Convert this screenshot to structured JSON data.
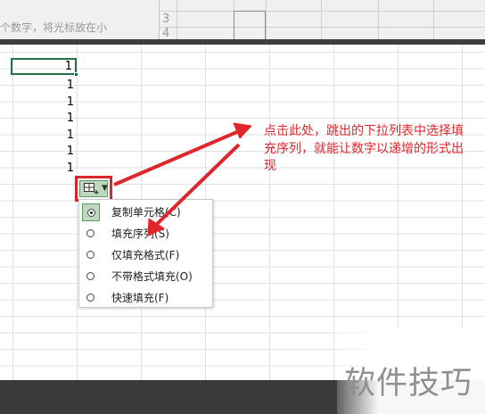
{
  "top_strip": {
    "hint_text": "个数字，将光标放在小",
    "row_numbers": [
      "3",
      "4"
    ]
  },
  "cells": {
    "values": [
      "1",
      "1",
      "1",
      "1",
      "1",
      "1",
      "1"
    ],
    "active_index": 0
  },
  "autofill_button": {
    "icon": "autofill-options-icon"
  },
  "menu": {
    "items": [
      {
        "label": "复制单元格(C)",
        "checked": true
      },
      {
        "label": "填充序列(S)",
        "checked": false
      },
      {
        "label": "仅填充格式(F)",
        "checked": false
      },
      {
        "label": "不带格式填充(O)",
        "checked": false
      },
      {
        "label": "快速填充(F)",
        "checked": false
      }
    ]
  },
  "annotation": {
    "text": "点击此处，跳出的下拉列表中选择填充序列，就能让数字以递增的形式出现"
  },
  "watermark": {
    "text": "软件技巧"
  },
  "colors": {
    "annotation": "#e1262b",
    "selection": "#217346",
    "checked_bg": "#bcd8bf"
  }
}
